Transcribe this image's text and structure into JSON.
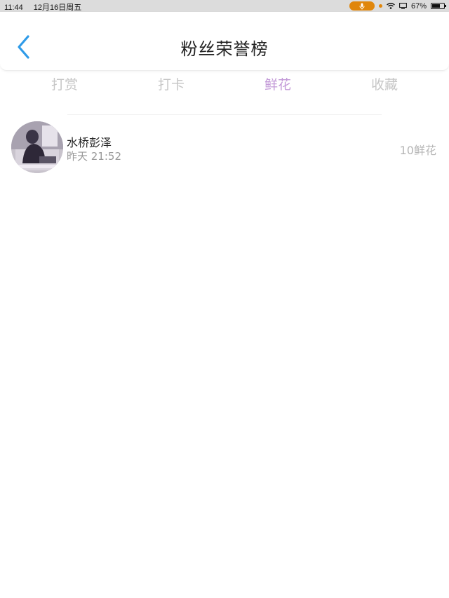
{
  "status_bar": {
    "time": "11:44",
    "date": "12月16日周五",
    "battery_text": "67%",
    "battery_level": 0.67,
    "icons": [
      "mic-icon",
      "orange-dot-icon",
      "wifi-icon",
      "screen-mirror-icon",
      "battery-icon"
    ]
  },
  "nav": {
    "title": "粉丝荣誉榜",
    "back_icon": "chevron-left-icon"
  },
  "colors": {
    "accent_blue": "#2f9be8",
    "tab_active": "#c39ad8",
    "tab_inactive": "#c6c6c6",
    "status_orange": "#e0860b"
  },
  "tabs": [
    {
      "label": "打赏",
      "active": false
    },
    {
      "label": "打卡",
      "active": false
    },
    {
      "label": "鲜花",
      "active": true
    },
    {
      "label": "收藏",
      "active": false
    }
  ],
  "list": [
    {
      "name": "水桥彭泽",
      "time": "昨天 21:52",
      "count": "10鲜花"
    }
  ]
}
